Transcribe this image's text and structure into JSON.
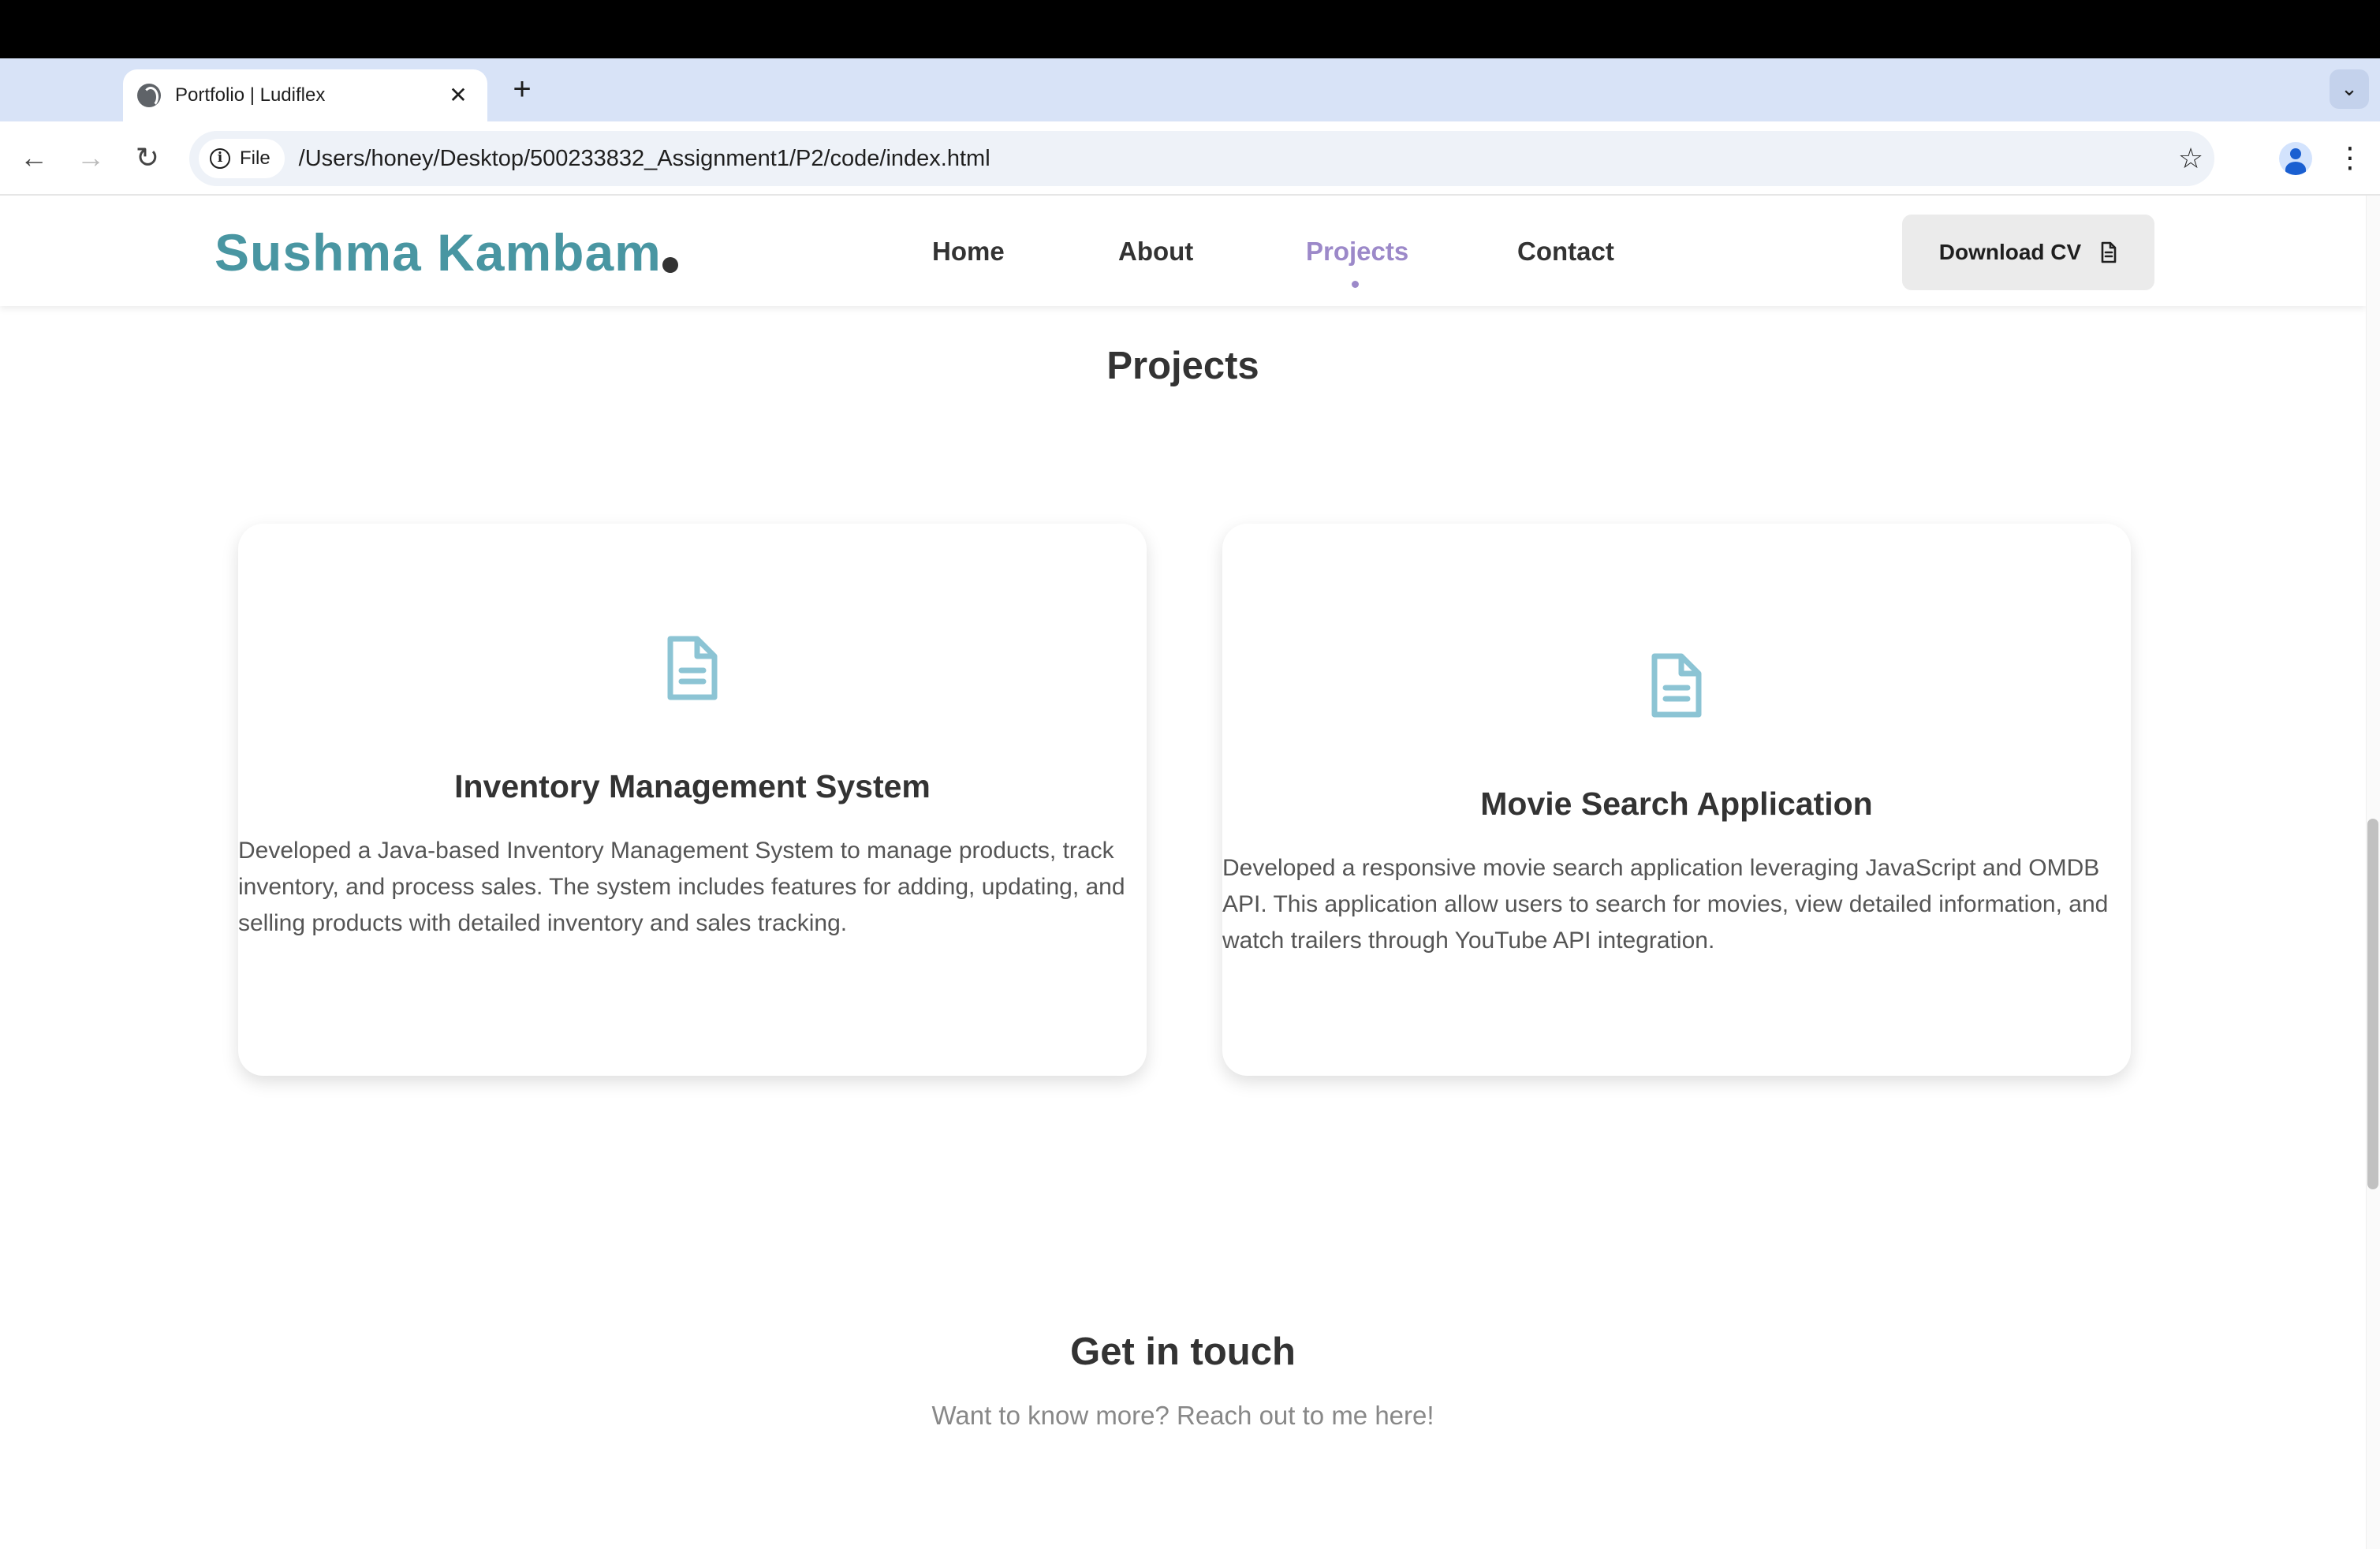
{
  "browser": {
    "tab_title": "Portfolio | Ludiflex",
    "tab_close": "✕",
    "new_tab": "+",
    "tab_search": "⌄",
    "site_chip": "File",
    "url": "/Users/honey/Desktop/500233832_Assignment1/P2/code/index.html",
    "back": "←",
    "forward": "→",
    "reload": "↻",
    "bookmark": "☆",
    "menu": "⋮"
  },
  "header": {
    "logo": "Sushma Kambam",
    "nav": [
      {
        "label": "Home",
        "active": false
      },
      {
        "label": "About",
        "active": false
      },
      {
        "label": "Projects",
        "active": true
      },
      {
        "label": "Contact",
        "active": false
      }
    ],
    "cv_button": "Download CV"
  },
  "projects": {
    "title": "Projects",
    "cards": [
      {
        "title": "Inventory Management System",
        "description": "Developed a Java-based Inventory Management System to manage products, track inventory, and process sales. The system includes features for adding, updating, and selling products with detailed inventory and sales tracking.",
        "icon": "document-icon"
      },
      {
        "title": "Movie Search Application",
        "description": "Developed a responsive movie search application leveraging JavaScript and OMDB API. This application allow users to search for movies, view detailed information, and watch trailers through YouTube API integration.",
        "icon": "document-icon"
      }
    ]
  },
  "contact": {
    "title": "Get in touch",
    "subtitle": "Want to know more? Reach out to me here!"
  },
  "colors": {
    "brand": "#4996a2",
    "accent": "#9c89c9",
    "icon": "#8cc4d4",
    "text": "#333333"
  }
}
